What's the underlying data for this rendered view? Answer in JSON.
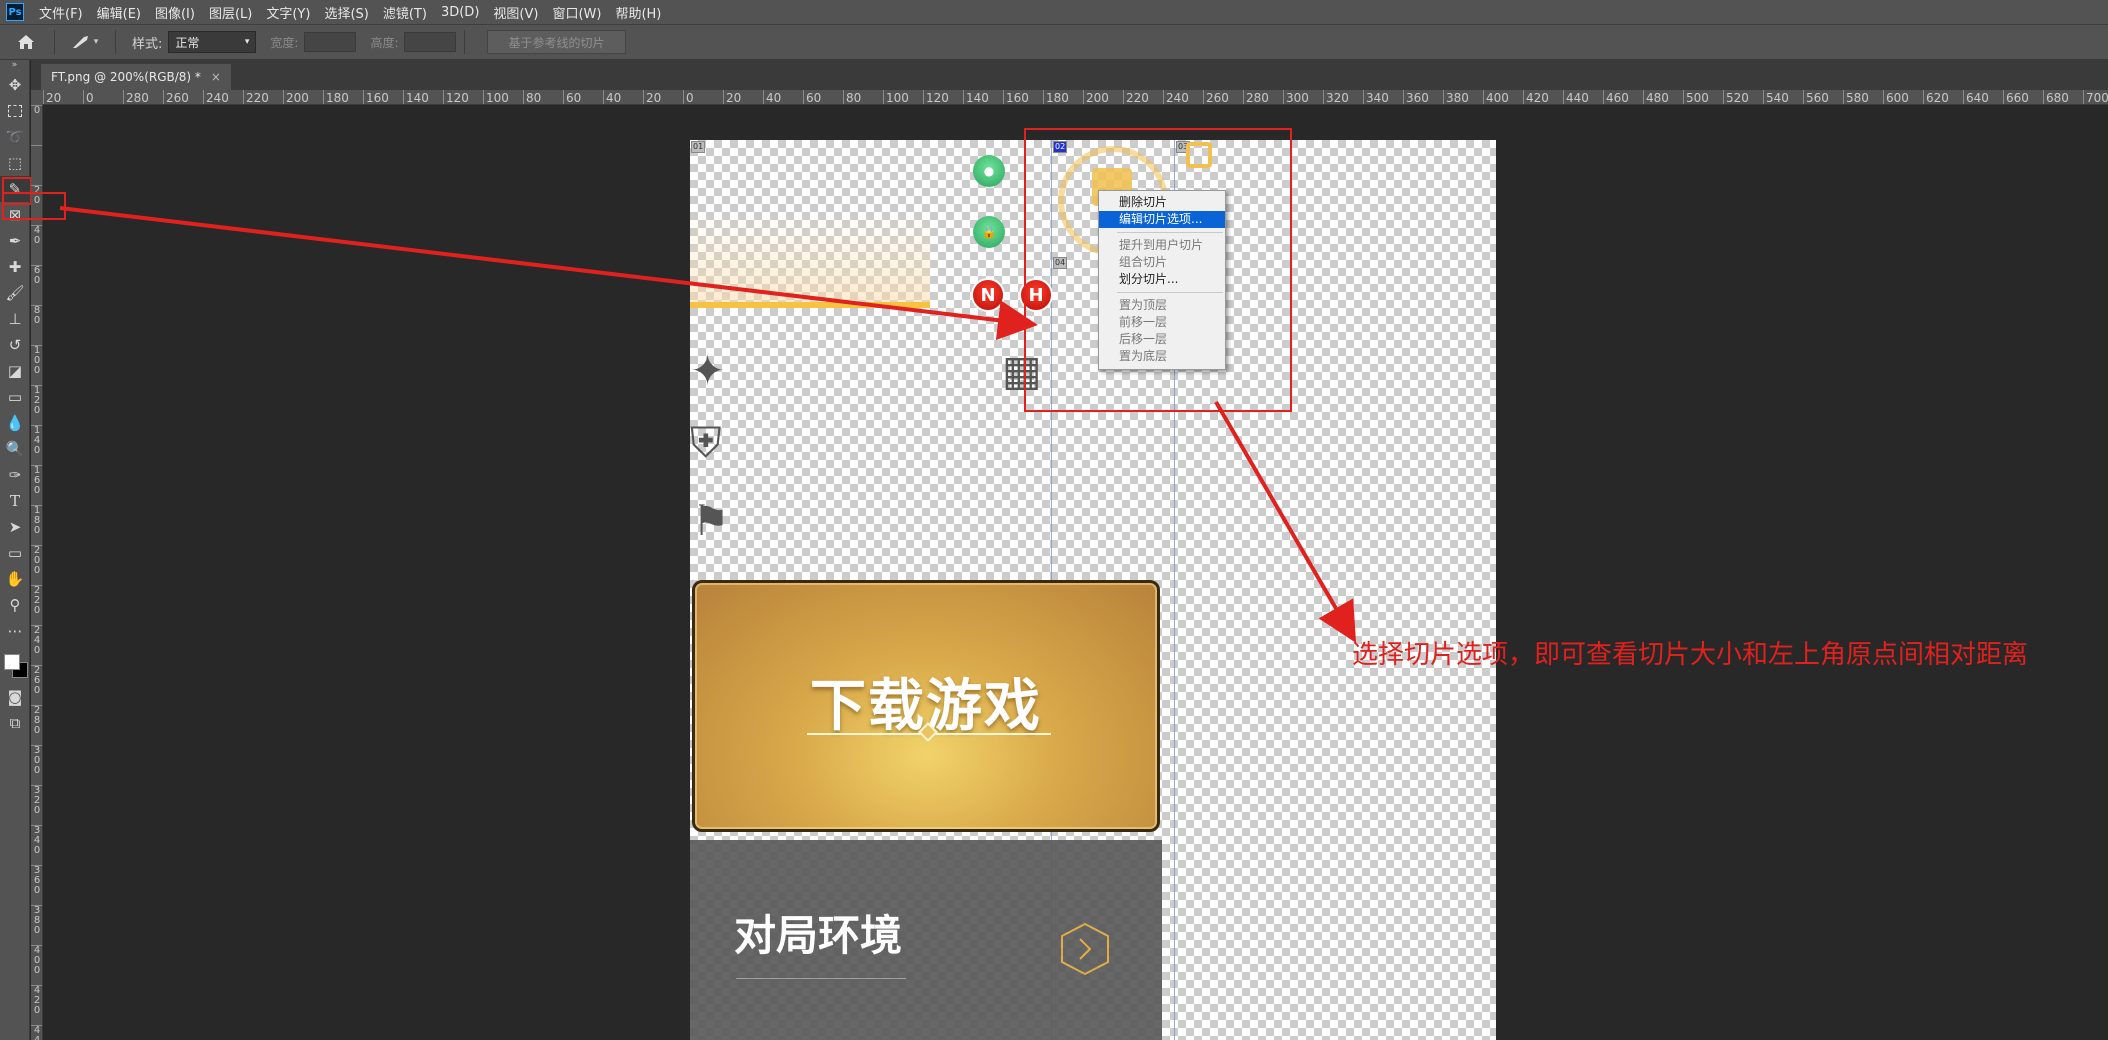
{
  "app": {
    "logo": "Ps",
    "menu": [
      "文件(F)",
      "编辑(E)",
      "图像(I)",
      "图层(L)",
      "文字(Y)",
      "选择(S)",
      "滤镜(T)",
      "3D(D)",
      "视图(V)",
      "窗口(W)",
      "帮助(H)"
    ]
  },
  "options": {
    "style_label": "样式:",
    "style_value": "正常",
    "width_label": "宽度:",
    "height_label": "高度:",
    "guide_slice_button": "基于参考线的切片"
  },
  "document_tab": {
    "title": "FT.png @ 200%(RGB/8) *",
    "close": "×"
  },
  "ruler_h": [
    "20",
    "0",
    "280",
    "260",
    "240",
    "220",
    "200",
    "180",
    "160",
    "140",
    "120",
    "100",
    "80",
    "60",
    "40",
    "20",
    "0",
    "20",
    "40",
    "60",
    "80",
    "100",
    "120",
    "140",
    "160",
    "180",
    "200",
    "220",
    "240",
    "260",
    "280",
    "300",
    "320",
    "340",
    "360",
    "380",
    "400",
    "420",
    "440",
    "460",
    "480",
    "500",
    "520",
    "540",
    "560",
    "580",
    "600",
    "620",
    "640",
    "660",
    "680",
    "700"
  ],
  "ruler_v": [
    "0",
    "",
    "2 0",
    "4 0",
    "6 0",
    "8 0",
    "1 0 0",
    "1 2 0",
    "1 4 0",
    "1 6 0",
    "1 8 0",
    "2 0 0",
    "2 2 0",
    "2 4 0",
    "2 6 0",
    "2 8 0",
    "3 0 0",
    "3 2 0",
    "3 4 0",
    "3 6 0",
    "3 8 0",
    "4 0 0",
    "4 2 0",
    "4 4 0"
  ],
  "slices": {
    "badge_01": "01",
    "badge_02": "02",
    "badge_03": "03",
    "badge_04": "04"
  },
  "canvas": {
    "btn_n": "N",
    "btn_h": "H",
    "download_text": "下载游戏",
    "env_text": "对局环境"
  },
  "context_menu": {
    "items": [
      {
        "label": "删除切片",
        "state": "normal"
      },
      {
        "label": "编辑切片选项...",
        "state": "highlighted"
      },
      {
        "label": "提升到用户切片",
        "state": "dim"
      },
      {
        "label": "组合切片",
        "state": "dim"
      },
      {
        "label": "划分切片...",
        "state": "normal"
      },
      {
        "label": "置为顶层",
        "state": "dim"
      },
      {
        "label": "前移一层",
        "state": "dim"
      },
      {
        "label": "后移一层",
        "state": "dim"
      },
      {
        "label": "置为底层",
        "state": "dim"
      }
    ]
  },
  "annotation": {
    "text": "选择切片选项，即可查看切片大小和左上角原点间相对距离",
    "color": "#e0211e"
  },
  "colors": {
    "accent_red": "#e0211e",
    "menu_highlight": "#0a64d6"
  }
}
